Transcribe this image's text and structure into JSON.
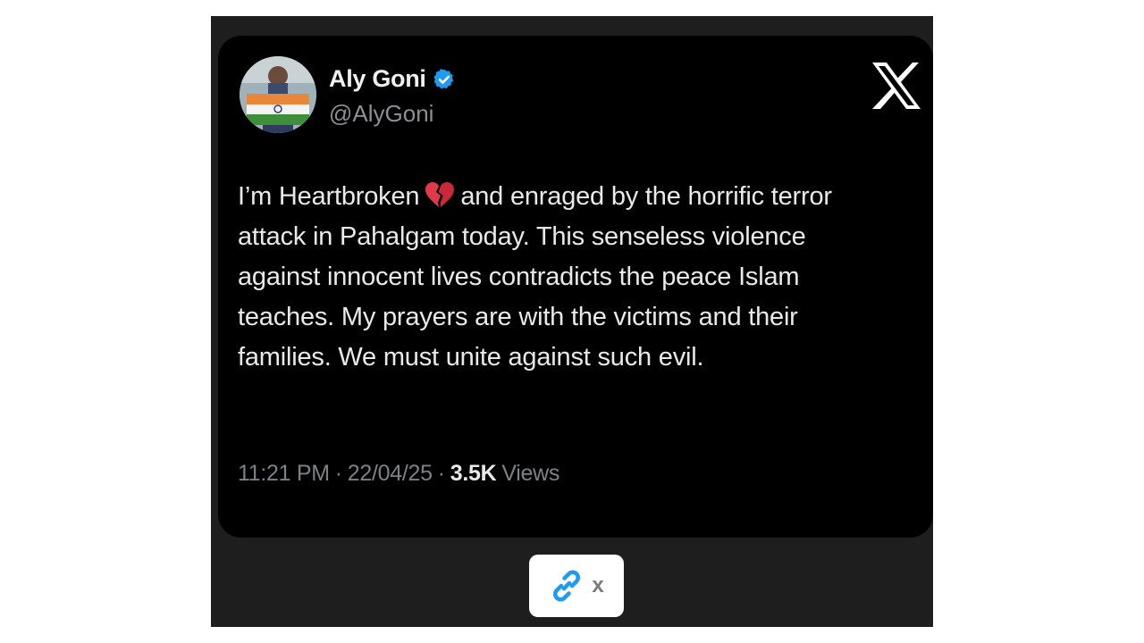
{
  "tweet": {
    "author_name": "Aly Goni",
    "handle": "@AlyGoni",
    "text_part1": "I’m Heartbroken",
    "text_part2": "and enraged by the horrific terror attack in Pahalgam today. This senseless violence against innocent lives contradicts the peace Islam teaches. My prayers are with the victims and their families. We must unite against such evil.",
    "time": "11:21 PM",
    "separator": "·",
    "date": "22/04/25",
    "views_count": "3.5K",
    "views_label": "Views",
    "emoji": "broken-heart-icon"
  },
  "share": {
    "close_label": "x"
  },
  "colors": {
    "background": "#000000",
    "frame": "#1e1e1e",
    "verified": "#1d9bf0",
    "link_icon": "#1d9bf0"
  }
}
